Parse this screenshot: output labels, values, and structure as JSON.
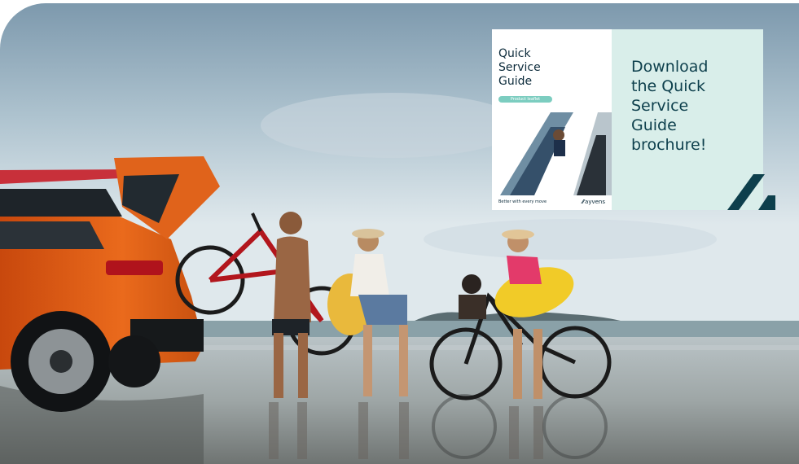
{
  "hero": {
    "alt_icon": "beach-car-bicycles-photo"
  },
  "promo": {
    "cover": {
      "title_line1": "Quick",
      "title_line2": "Service",
      "title_line3": "Guide",
      "pill": "Product leaflet",
      "tagline": "Better with every move",
      "brand": "ayvens",
      "brand_mark_icon": "ayvens-logo-icon"
    },
    "cta": {
      "line1": "Download",
      "line2": "the Quick",
      "line3": "Service",
      "line4": "Guide",
      "line5": "brochure!"
    }
  },
  "colors": {
    "panel_bg": "#d9eeea",
    "brand_dark": "#0d3f4c",
    "accent_teal": "#7ccdc0"
  }
}
